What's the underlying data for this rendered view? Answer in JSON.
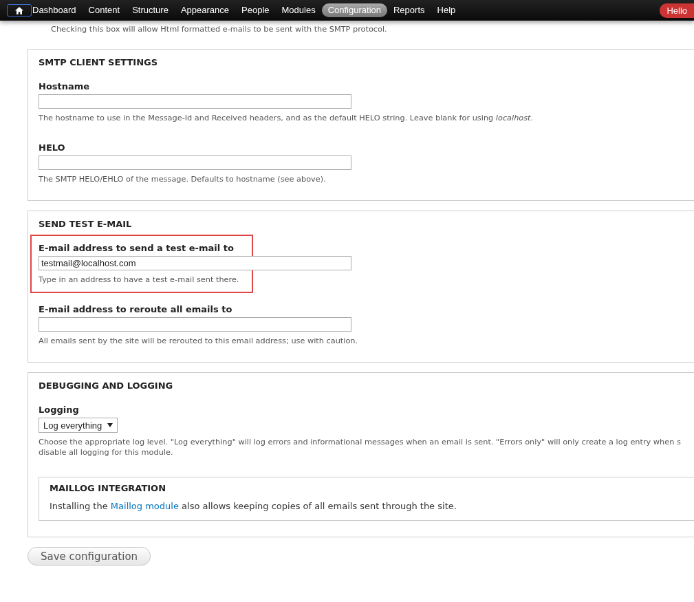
{
  "toolbar": {
    "items": [
      {
        "kind": "home",
        "selected": false,
        "focused": true
      },
      {
        "kind": "link",
        "label": "Dashboard",
        "selected": false,
        "focused": false
      },
      {
        "kind": "link",
        "label": "Content",
        "selected": false,
        "focused": false
      },
      {
        "kind": "link",
        "label": "Structure",
        "selected": false,
        "focused": false
      },
      {
        "kind": "link",
        "label": "Appearance",
        "selected": false,
        "focused": false
      },
      {
        "kind": "link",
        "label": "People",
        "selected": false,
        "focused": false
      },
      {
        "kind": "link",
        "label": "Modules",
        "selected": false,
        "focused": false
      },
      {
        "kind": "link",
        "label": "Configuration",
        "selected": true,
        "focused": false
      },
      {
        "kind": "link",
        "label": "Reports",
        "selected": false,
        "focused": false
      },
      {
        "kind": "link",
        "label": "Help",
        "selected": false,
        "focused": false
      }
    ],
    "greeting": "Hello"
  },
  "intro_text": "Checking this box will allow Html formatted e-mails to be sent with the SMTP protocol.",
  "sections": [
    {
      "title": "SMTP CLIENT SETTINGS",
      "fields": [
        {
          "kind": "text",
          "label": "Hostname",
          "highlighted": false,
          "description": "The hostname to use in the Message-Id and Received headers, and as the default HELO string. Leave blank for using *localhost*."
        },
        {
          "kind": "text",
          "label": "HELO",
          "highlighted": false,
          "description": "The SMTP HELO/EHLO of the message. Defaults to hostname (see above)."
        }
      ]
    },
    {
      "title": "SEND TEST E-MAIL",
      "fields": [
        {
          "kind": "text",
          "label": "E-mail address to send a test e-mail to",
          "value": "testmail@localhost.com",
          "highlighted": true,
          "description": "Type in an address to have a test e-mail sent there."
        },
        {
          "kind": "text",
          "label": "E-mail address to reroute all emails to",
          "highlighted": false,
          "description": "All emails sent by the site will be rerouted to this email address; use with caution."
        }
      ]
    },
    {
      "title": "DEBUGGING AND LOGGING",
      "fields": [
        {
          "kind": "select",
          "label": "Logging",
          "value": "Log everything",
          "highlighted": false,
          "description_lines": [
            "Choose the appropriate log level. \"Log everything\" will log errors and informational messages when an email is sent. \"Errors only\" will only create a log entry when s",
            "disable all logging for this module."
          ]
        },
        {
          "kind": "note",
          "title": "MAILLOG INTEGRATION",
          "text_before": "Installing the ",
          "link": "Maillog module",
          "text_after": " also allows keeping copies of all emails sent through the site."
        }
      ]
    }
  ],
  "submit": "Save configuration"
}
